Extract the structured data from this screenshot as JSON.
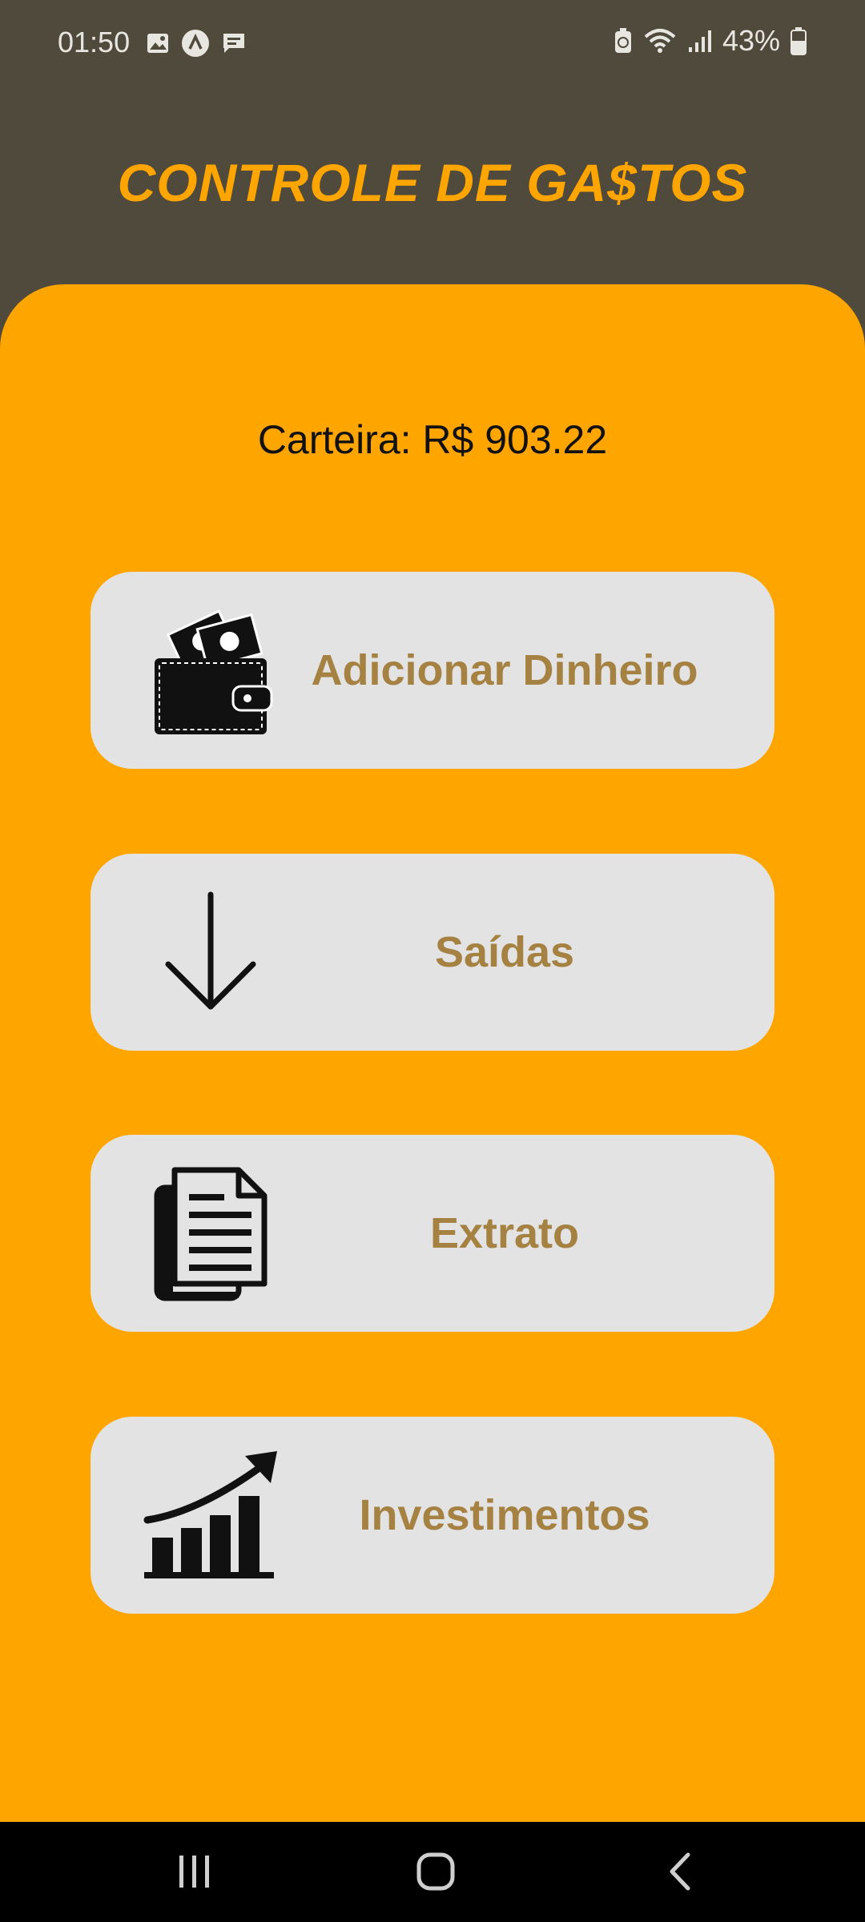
{
  "status_bar": {
    "time": "01:50",
    "battery": "43%",
    "icons": [
      "image-icon",
      "app-icon",
      "message-icon",
      "battery-saver-icon",
      "wifi-icon",
      "signal-icon",
      "battery-icon"
    ]
  },
  "app": {
    "title": "CONTROLE DE GA$TOS",
    "wallet_label": "Carteira: R$ 903.22"
  },
  "menu": [
    {
      "label": "Adicionar Dinheiro",
      "icon": "wallet-money-icon"
    },
    {
      "label": "Saídas",
      "icon": "arrow-down-icon"
    },
    {
      "label": "Extrato",
      "icon": "document-icon"
    },
    {
      "label": "Investimentos",
      "icon": "growth-chart-icon"
    }
  ],
  "nav_bar": {
    "buttons": [
      "recent-apps-icon",
      "home-icon",
      "back-icon"
    ]
  },
  "colors": {
    "header_bg": "#4f4a3c",
    "accent": "#ffa500",
    "button_bg": "#e3e3e3",
    "button_text": "#a58142"
  }
}
